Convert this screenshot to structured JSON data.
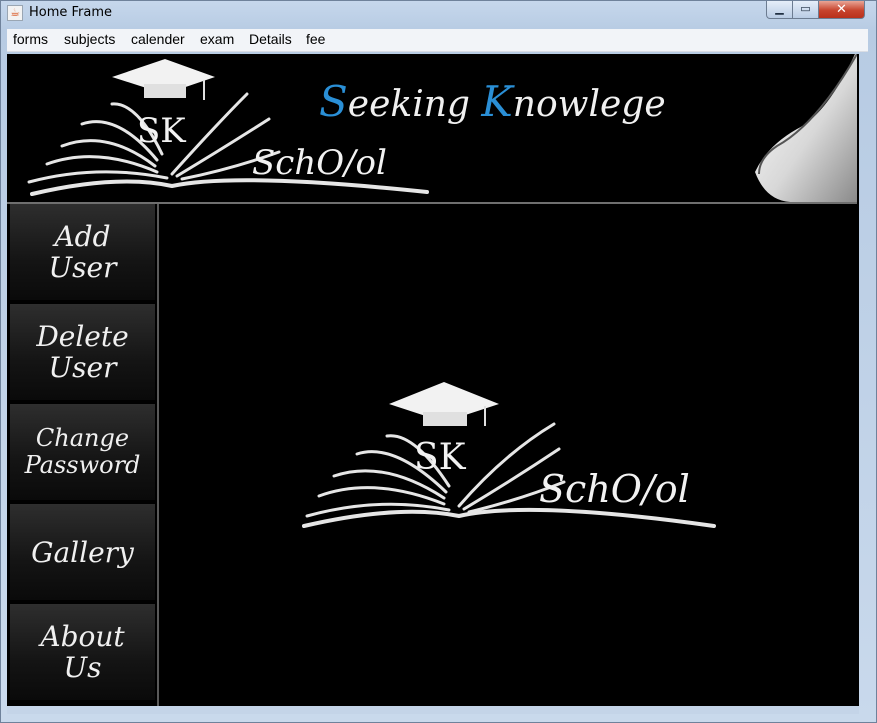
{
  "window": {
    "title": "Home Frame",
    "close_label": "✕"
  },
  "menu": {
    "items": [
      "forms",
      "subjects",
      "calender",
      "exam",
      "Details",
      "fee"
    ]
  },
  "banner": {
    "heading_first_initial": "S",
    "heading_first_rest": "eeking ",
    "heading_second_initial": "K",
    "heading_second_rest": "nowlege",
    "logo_initials": "SK",
    "logo_word": "SchO/ol"
  },
  "sidebar": {
    "buttons": [
      {
        "label": "Add\nUser"
      },
      {
        "label": "Delete\nUser"
      },
      {
        "label": "Change\nPassword"
      },
      {
        "label": "Gallery"
      },
      {
        "label": "About\nUs"
      }
    ]
  },
  "main": {
    "logo_initials": "SK",
    "logo_word": "SchO/ol"
  },
  "colors": {
    "accent_blue": "#2a8fd6",
    "content_bg": "#000000",
    "text_light": "#f0f0f0"
  }
}
